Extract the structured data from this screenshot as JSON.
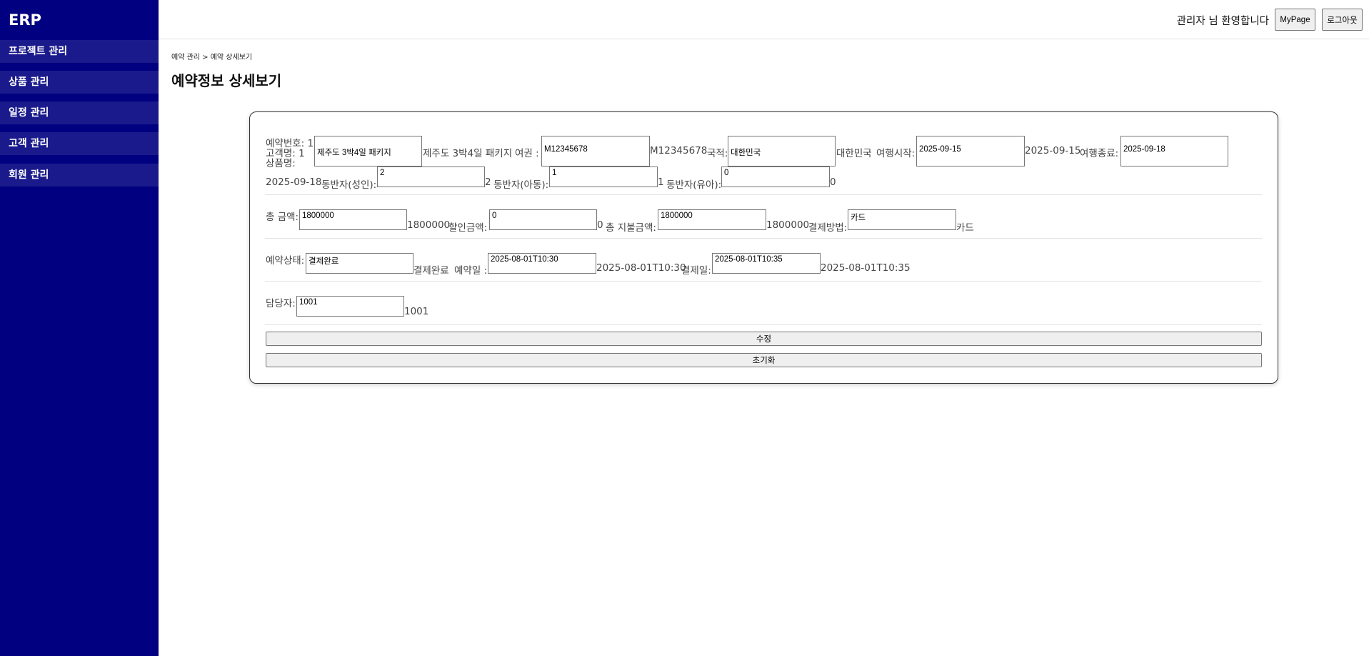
{
  "sidebar": {
    "brand": "ERP",
    "items": [
      {
        "label": "프로젝트 관리"
      },
      {
        "label": "상품 관리"
      },
      {
        "label": "일정 관리"
      },
      {
        "label": "고객 관리"
      },
      {
        "label": "회원 관리"
      }
    ]
  },
  "header": {
    "welcome": "관리자 님 환영합니다",
    "mypage_label": "MyPage",
    "logout_label": "로그아웃"
  },
  "breadcrumb": "예약 관리 > 예약 상세보기",
  "page_title": "예약정보 상세보기",
  "form": {
    "reservation_no_label": "예약번호: 1",
    "customer_name_label": "고객명: 1",
    "product_name_label": "상품명:",
    "product_name_value": "제주도 3박4일 패키지",
    "product_name_text": "제주도 3박4일 패키지",
    "passport_label": "여권 :",
    "passport_value": "M12345678",
    "passport_text": "M12345678",
    "nationality_label": "국적:",
    "nationality_value": "대한민국",
    "nationality_text": "대한민국",
    "trip_start_label": "여행시작:",
    "trip_start_value": "2025-09-15",
    "trip_start_text": "2025-09-15",
    "trip_end_label": "여행종료:",
    "trip_end_value": "2025-09-18",
    "trip_end_text": "2025-09-18",
    "adult_label": "동반자(성인):",
    "adult_value": "2",
    "adult_text": "2",
    "child_label": "동반자(아동):",
    "child_value": "1",
    "child_text": "1",
    "infant_label": "동반자(유아):",
    "infant_value": "0",
    "infant_text": "0",
    "total_label": "총 금액:",
    "total_value": "1800000",
    "total_text": "1800000",
    "discount_label": "할인금액:",
    "discount_value": "0",
    "discount_text": "0",
    "paid_label": "총 지불금액:",
    "paid_value": "1800000",
    "paid_text": "1800000",
    "method_label": "결제방법:",
    "method_value": "카드",
    "method_text": "카드",
    "status_label": "예약상태:",
    "status_value": "결제완료",
    "status_text": "결제완료",
    "reserve_date_label": "예약일 :",
    "reserve_date_value": "2025-08-01T10:30",
    "reserve_date_text": "2025-08-01T10:30",
    "pay_date_label": "결제일:",
    "pay_date_value": "2025-08-01T10:35",
    "pay_date_text": "2025-08-01T10:35",
    "manager_label": "담당자:",
    "manager_value": "1001",
    "manager_text": "1001"
  },
  "buttons": {
    "edit_label": "수정",
    "reset_label": "초기화"
  }
}
